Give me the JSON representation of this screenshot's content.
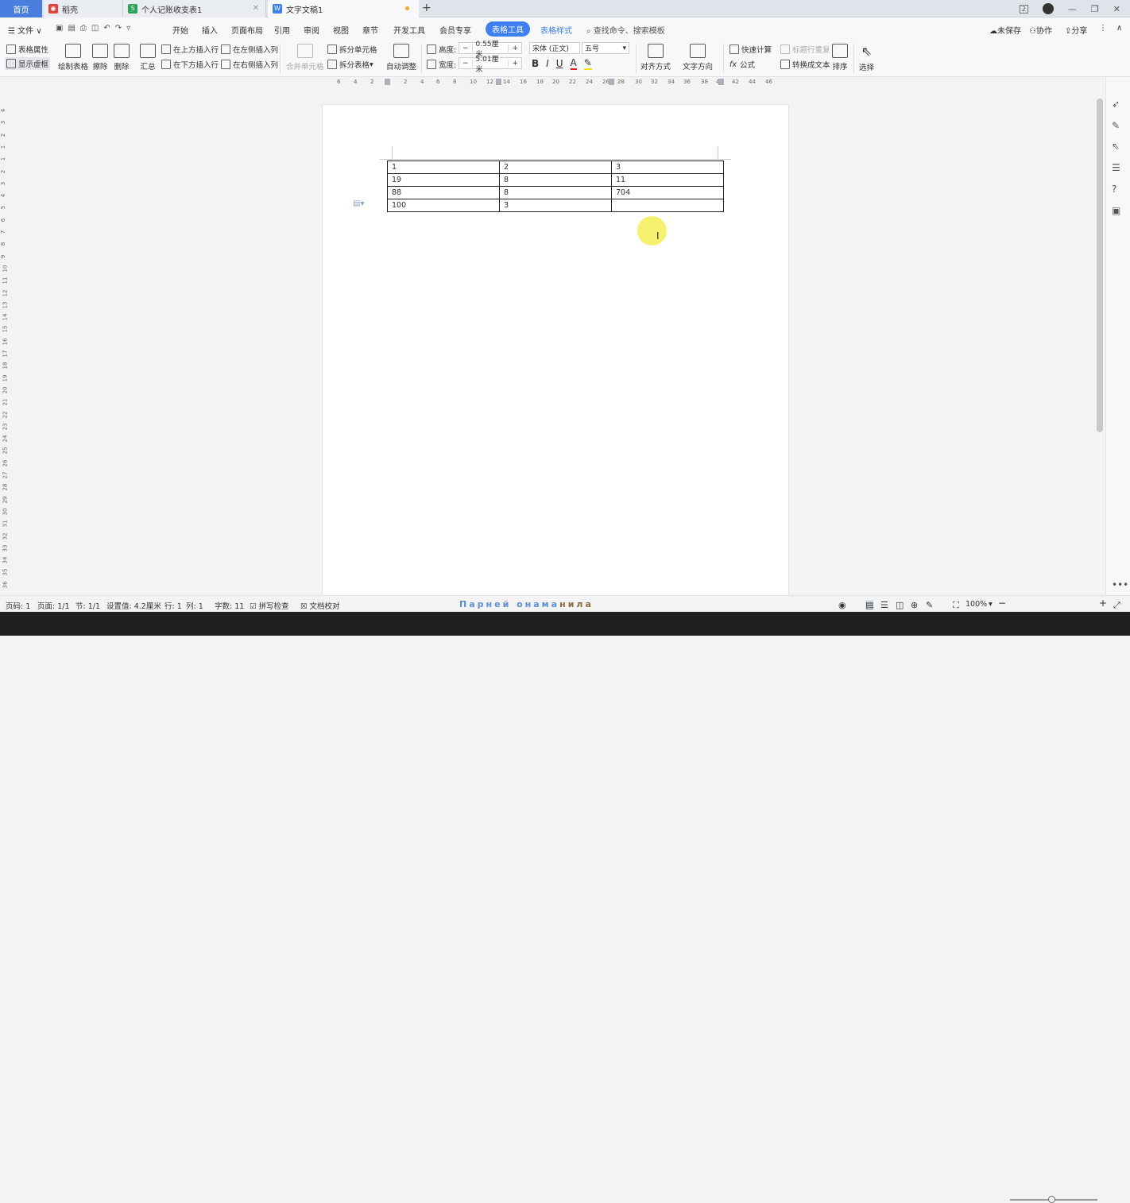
{
  "tabs": {
    "home": "首页",
    "t1": "稻壳",
    "t2": "个人记账收支表1",
    "t3": "文字文稿1",
    "new_tab": "+"
  },
  "window": {
    "page_count_badge": "2",
    "minimize": "—",
    "restore": "❐",
    "close": "✕"
  },
  "menu": {
    "file": "文件",
    "items": [
      "开始",
      "插入",
      "页面布局",
      "引用",
      "审阅",
      "视图",
      "章节",
      "开发工具",
      "会员专享"
    ],
    "table_tools": "表格工具",
    "table_style": "表格样式",
    "search_placeholder": "查找命令、搜索模板",
    "unsaved": "未保存",
    "collab": "协作",
    "share": "分享"
  },
  "ribbon": {
    "table_props": "表格属性",
    "show_grid": "显示虚框",
    "draw_table": "绘制表格",
    "erase": "擦除",
    "delete": "删除",
    "summary": "汇总",
    "insert_above": "在上方插入行",
    "insert_below": "在下方插入行",
    "insert_left": "在左侧插入列",
    "insert_right": "在右侧插入列",
    "merge_cells": "合并单元格",
    "split_cells": "拆分单元格",
    "split_table": "拆分表格",
    "auto_fit": "自动调整",
    "height_label": "高度:",
    "height_value": "0.55厘米",
    "width_label": "宽度:",
    "width_value": "5.01厘米",
    "font_name": "宋体 (正文)",
    "font_size": "五号",
    "align": "对齐方式",
    "text_direction": "文字方向",
    "quick_calc": "快速计算",
    "repeat_header": "标题行重复",
    "formula": "公式",
    "convert_text": "转换成文本",
    "sort": "排序",
    "select": "选择"
  },
  "ruler": {
    "h_numbers": [
      "6",
      "4",
      "2",
      "2",
      "4",
      "6",
      "8",
      "10",
      "12",
      "14",
      "16",
      "18",
      "20",
      "22",
      "24",
      "26",
      "28",
      "30",
      "32",
      "34",
      "36",
      "38",
      "40",
      "42",
      "44",
      "46"
    ],
    "v_numbers": [
      "4",
      "3",
      "2",
      "1",
      "1",
      "2",
      "3",
      "4",
      "5",
      "6",
      "7",
      "8",
      "9",
      "10",
      "11",
      "12",
      "13",
      "14",
      "15",
      "16",
      "17",
      "18",
      "19",
      "20",
      "21",
      "22",
      "23",
      "24",
      "25",
      "26",
      "27",
      "28",
      "29",
      "30",
      "31",
      "32",
      "33",
      "34",
      "35",
      "36"
    ]
  },
  "table": {
    "rows": [
      [
        "1",
        "2",
        "3"
      ],
      [
        "19",
        "8",
        "11"
      ],
      [
        "88",
        "8",
        "704"
      ],
      [
        "100",
        "3",
        ""
      ]
    ]
  },
  "status": {
    "page_no": "页码: 1",
    "pages": "页面: 1/1",
    "section": "节: 1/1",
    "setting": "设置值: 4.2厘米",
    "row": "行: 1",
    "col": "列: 1",
    "words": "字数: 11",
    "spellcheck": "拼写检查",
    "doc_check": "文档校对",
    "marquee_main": "Парней онама",
    "marquee_tail": "нила",
    "zoom": "100%"
  }
}
